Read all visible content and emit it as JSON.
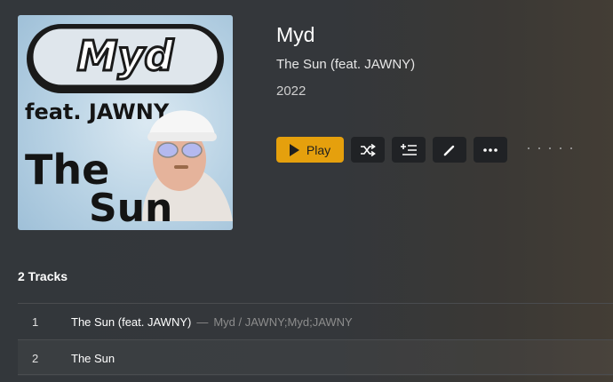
{
  "cover": {
    "artist_logo": "Myd",
    "feat_text": "feat. JAWNY",
    "title_text": [
      "The",
      "Sun"
    ]
  },
  "header": {
    "artist": "Myd",
    "album": "The Sun (feat. JAWNY)",
    "year": "2022"
  },
  "toolbar": {
    "play_label": "Play",
    "icons": [
      "shuffle-icon",
      "add-to-queue-icon",
      "edit-icon",
      "more-icon"
    ]
  },
  "tracks": {
    "heading": "2 Tracks",
    "items": [
      {
        "number": "1",
        "title": "The Sun (feat. JAWNY)",
        "separator": "—",
        "artists": "Myd / JAWNY;Myd;JAWNY"
      },
      {
        "number": "2",
        "title": "The Sun",
        "separator": "",
        "artists": ""
      }
    ]
  },
  "colors": {
    "accent": "#e5a00d",
    "button_bg": "#202225",
    "muted_text": "#8d8d8d"
  }
}
